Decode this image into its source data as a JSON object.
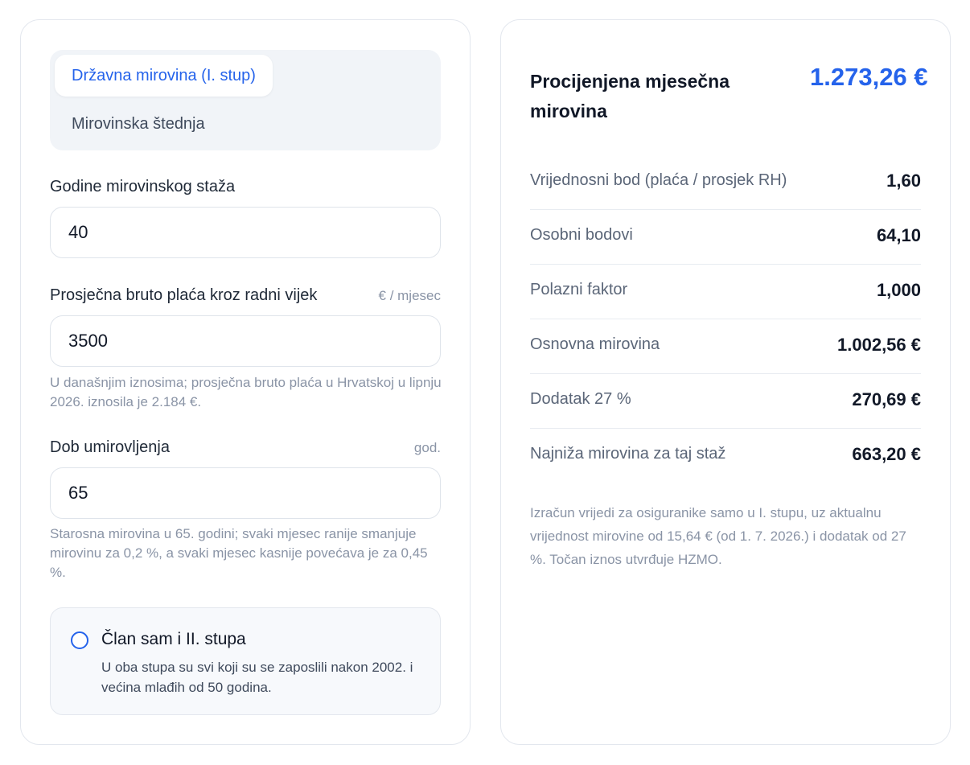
{
  "calculator": {
    "tabs": [
      {
        "label": "Državna mirovina (I. stup)",
        "active": true
      },
      {
        "label": "Mirovinska štednja",
        "active": false
      }
    ],
    "years": {
      "label": "Godine mirovinskog staža",
      "value": "40"
    },
    "salary": {
      "label": "Prosječna bruto plaća kroz radni vijek",
      "unit": "€ / mjesec",
      "value": "3500",
      "hint": "U današnjim iznosima; prosječna bruto plaća u Hrvatskoj u lipnju 2026. iznosila je 2.184 €."
    },
    "age": {
      "label": "Dob umirovljenja",
      "unit": "god.",
      "value": "65",
      "hint": "Starosna mirovina u 65. godini; svaki mjesec ranije smanjuje mirovinu za 0,2 %, a svaki mjesec kasnije povećava je za 0,45 %."
    },
    "pillar2": {
      "title": "Član sam i II. stupa",
      "description": "U oba stupa su svi koji su se zaposlili nakon 2002. i većina mlađih od 50 godina.",
      "checked": false
    }
  },
  "result": {
    "label": "Procijenjena mjesečna mirovina",
    "value": "1.273,26 €",
    "rows": [
      {
        "label": "Vrijednosni bod (plaća / prosjek RH)",
        "value": "1,60"
      },
      {
        "label": "Osobni bodovi",
        "value": "64,10"
      },
      {
        "label": "Polazni faktor",
        "value": "1,000"
      },
      {
        "label": "Osnovna mirovina",
        "value": "1.002,56 €"
      },
      {
        "label": "Dodatak 27 %",
        "value": "270,69 €"
      },
      {
        "label": "Najniža mirovina za taj staž",
        "value": "663,20 €"
      }
    ],
    "note": "Izračun vrijedi za osiguranike samo u I. stupu, uz aktualnu vrijednost mirovine od 15,64 € (od 1. 7. 2026.) i dodatak od 27 %. Točan iznos utvrđuje HZMO."
  },
  "colors": {
    "accent": "#2563eb",
    "muted_text": "#8a94a6",
    "border": "#e3e7ee"
  }
}
